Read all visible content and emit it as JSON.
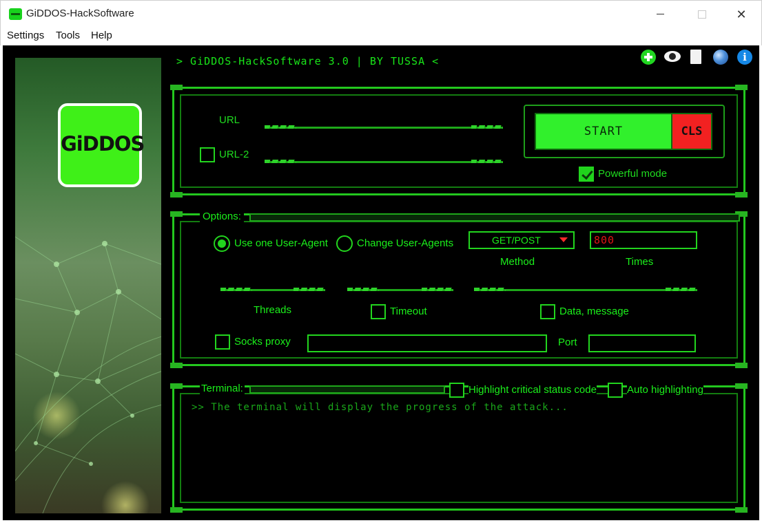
{
  "window": {
    "title": "GiDDOS-HackSoftware",
    "min_glyph": "",
    "max_glyph": "",
    "close_glyph": "✕"
  },
  "menu": [
    "Settings",
    "Tools",
    "Help"
  ],
  "header": {
    "text": "> GiDDOS-HackSoftware 3.0 | BY TUSSA <",
    "icons": [
      "plus-icon",
      "eye-icon",
      "document-icon",
      "globe-icon",
      "info-icon"
    ],
    "info_glyph": "i"
  },
  "logo": {
    "text": "GiDDOS"
  },
  "target": {
    "url_label": "URL",
    "url2_label": "URL-2",
    "url2_checked": false,
    "start_label": "START",
    "cls_label": "CLS",
    "powerful_mode_label": "Powerful mode",
    "powerful_mode_checked": true
  },
  "options": {
    "title": "Options:",
    "user_agent_one": "Use one User-Agent",
    "user_agent_change": "Change User-Agents",
    "user_agent_selected": "Use one User-Agent",
    "method_value": "GET/POST",
    "method_label": "Method",
    "times_value": "800",
    "times_label": "Times",
    "threads_label": "Threads",
    "timeout_label": "Timeout",
    "timeout_checked": false,
    "data_label": "Data, message",
    "data_checked": false,
    "socks_label": "Socks proxy",
    "socks_checked": false,
    "port_label": "Port"
  },
  "terminal": {
    "title": "Terminal:",
    "highlight_critical_label": "Highlight critical status code",
    "highlight_critical_checked": false,
    "auto_highlight_label": "Auto highlighting",
    "auto_highlight_checked": false,
    "output": ">> The terminal will display the progress of the attack..."
  },
  "colors": {
    "accent": "#22d51e",
    "start": "#31f02c",
    "cls": "#f22121",
    "background": "#000000"
  }
}
